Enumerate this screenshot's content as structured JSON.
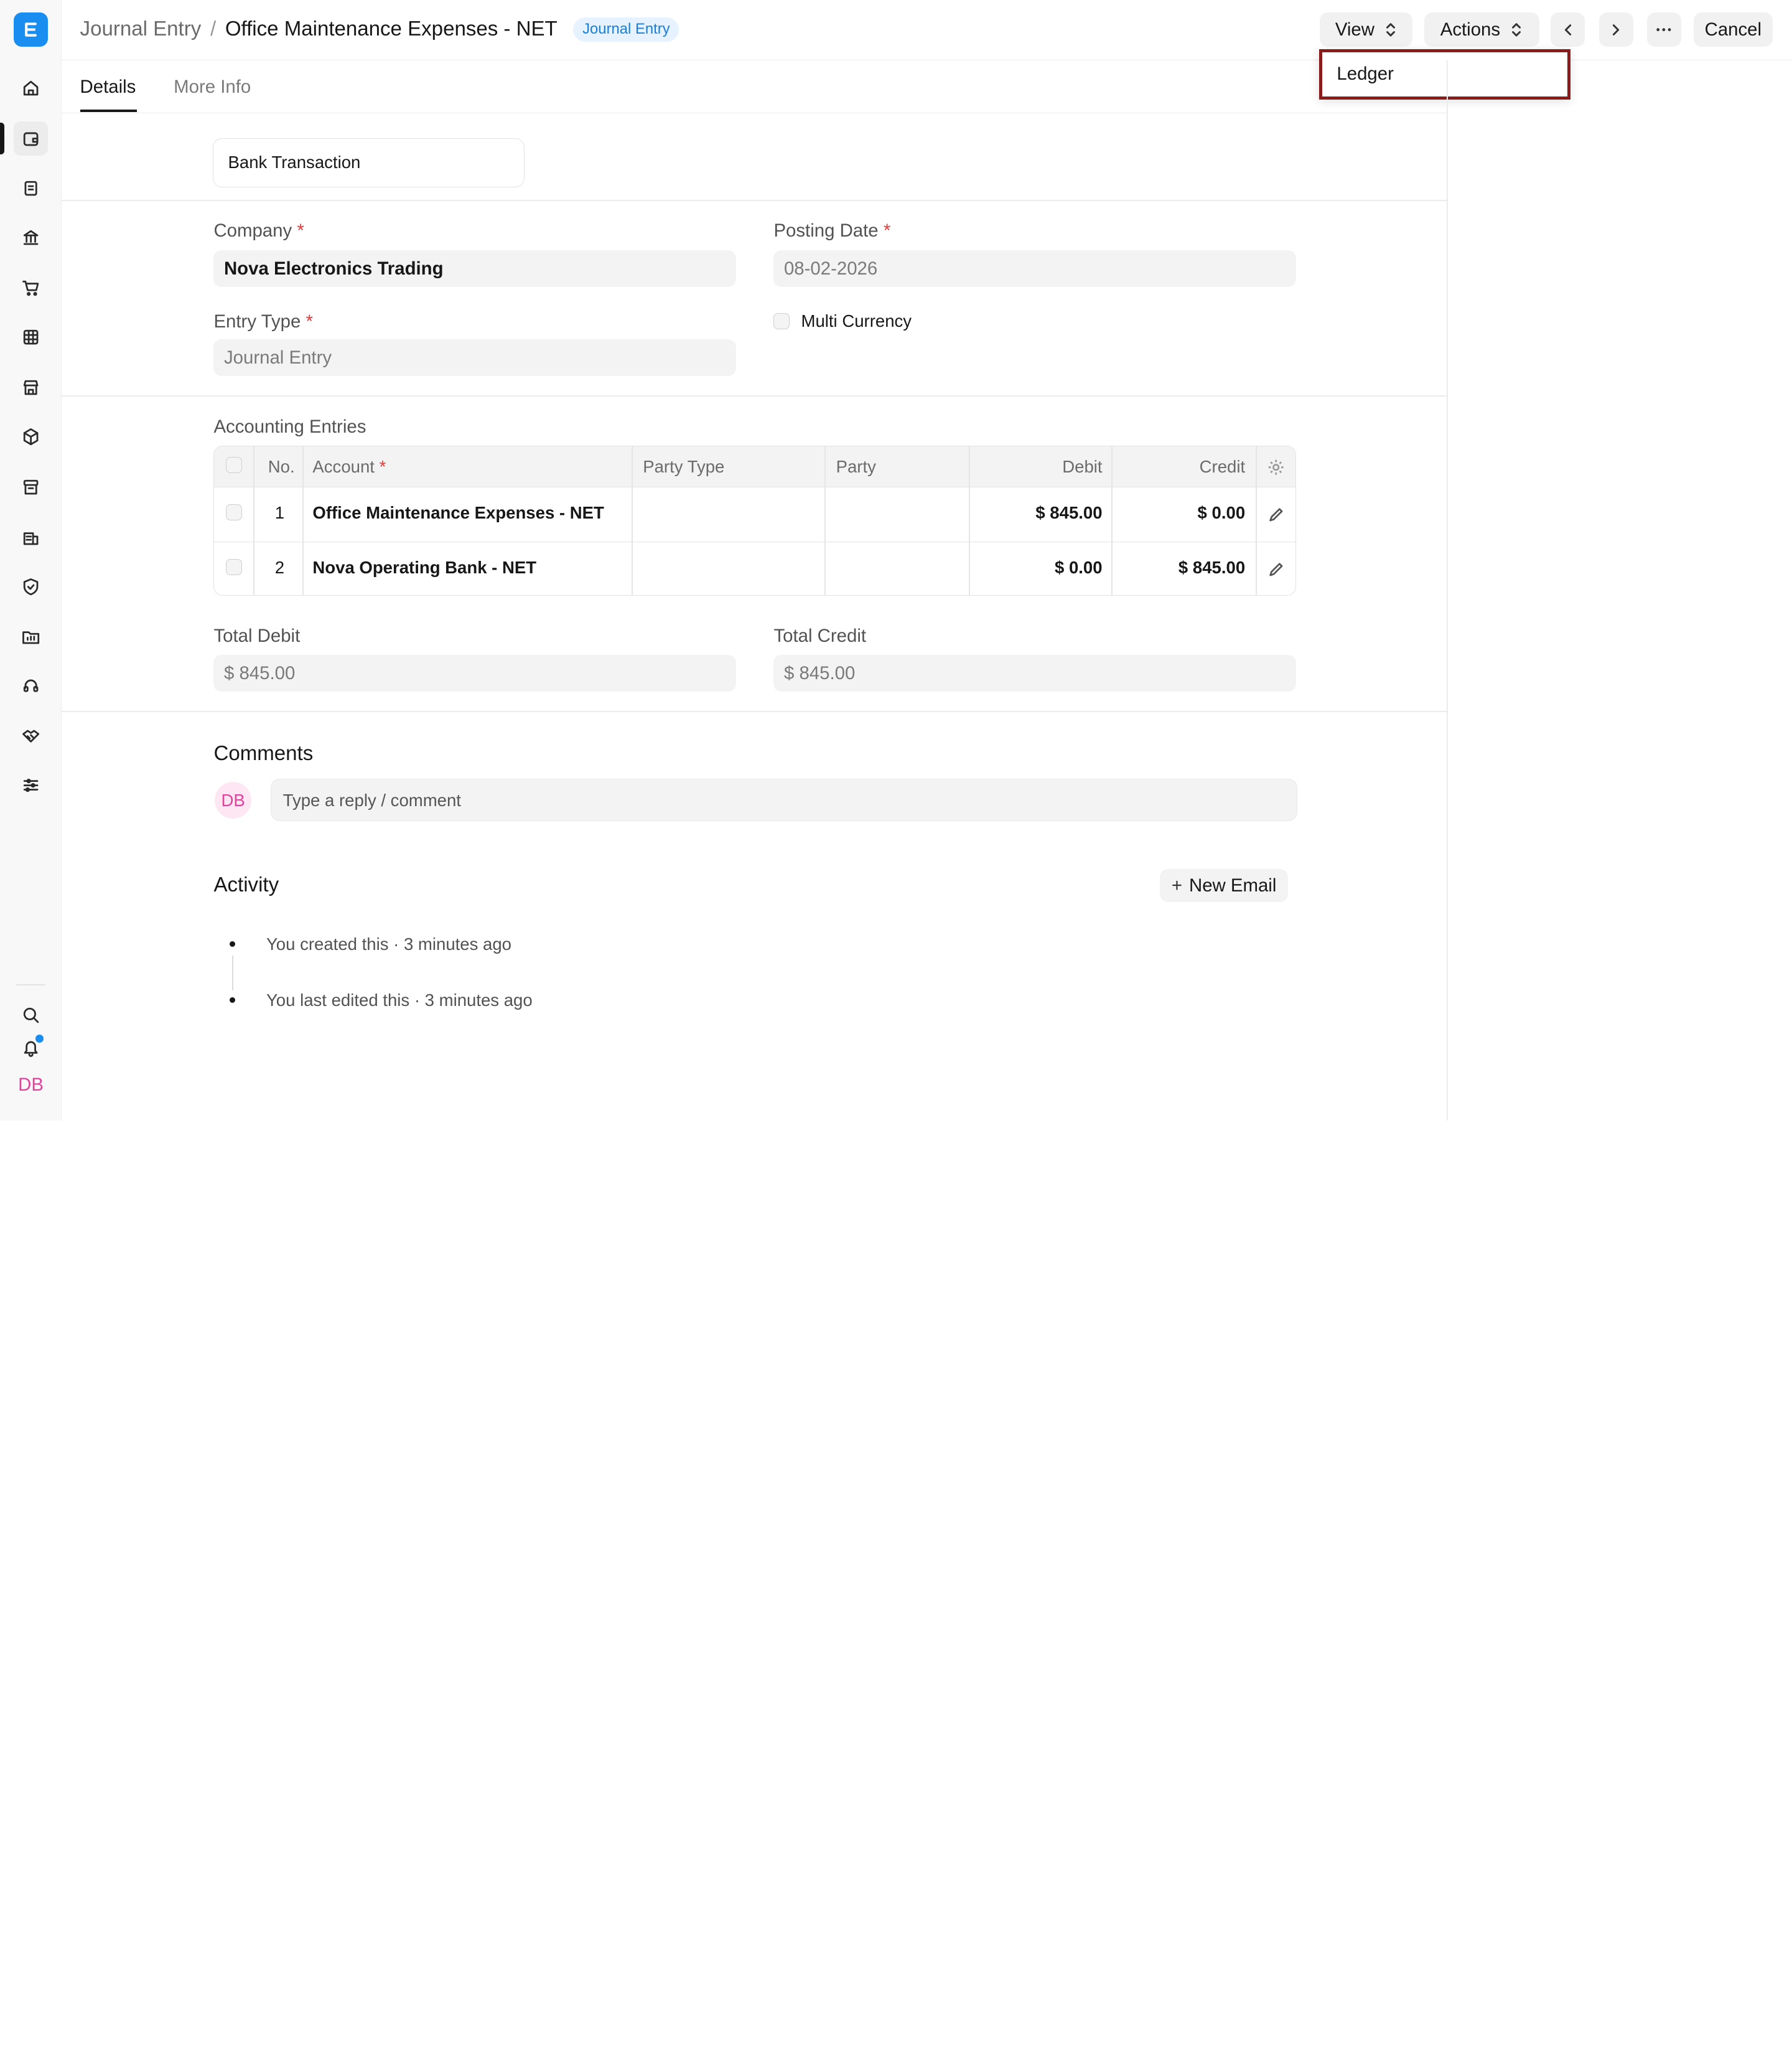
{
  "breadcrumb": {
    "parent": "Journal Entry",
    "separator": "/",
    "current": "Office Maintenance Expenses - NET",
    "status_badge": "Journal Entry"
  },
  "header": {
    "view_label": "View",
    "actions_label": "Actions",
    "cancel_label": "Cancel"
  },
  "view_menu": {
    "items": [
      "Ledger"
    ]
  },
  "tabs": [
    "Details",
    "More Info"
  ],
  "form": {
    "bank_transaction_label": "Bank Transaction",
    "company_label": "Company",
    "company_value": "Nova Electronics Trading",
    "posting_date_label": "Posting Date",
    "posting_date_value": "08-02-2026",
    "entry_type_label": "Entry Type",
    "entry_type_value": "Journal Entry",
    "multi_currency_label": "Multi Currency",
    "required_marker": "*"
  },
  "accounting": {
    "title": "Accounting Entries",
    "columns": [
      "No.",
      "Account",
      "Party Type",
      "Party",
      "Debit",
      "Credit"
    ],
    "rows": [
      {
        "no": "1",
        "account": "Office Maintenance Expenses - NET",
        "party_type": "",
        "party": "",
        "debit": "$ 845.00",
        "credit": "$ 0.00"
      },
      {
        "no": "2",
        "account": "Nova Operating Bank - NET",
        "party_type": "",
        "party": "",
        "debit": "$ 0.00",
        "credit": "$ 845.00"
      }
    ]
  },
  "totals": {
    "debit_label": "Total Debit",
    "debit_value": "$ 845.00",
    "credit_label": "Total Credit",
    "credit_value": "$ 845.00"
  },
  "comments": {
    "title": "Comments",
    "avatar_initials": "DB",
    "placeholder": "Type a reply / comment"
  },
  "activity": {
    "title": "Activity",
    "new_email_label": "New Email",
    "items": [
      "You created this · 3 minutes ago",
      "You last edited this · 3 minutes ago"
    ]
  },
  "sidebar": {
    "user_initials": "DB"
  },
  "colors": {
    "accent": "#1a8ef0",
    "badge_text": "#1a7ed6",
    "badge_bg": "#e6f2ff",
    "highlight_border": "#8b1c1c",
    "avatar_text": "#e0439b"
  }
}
